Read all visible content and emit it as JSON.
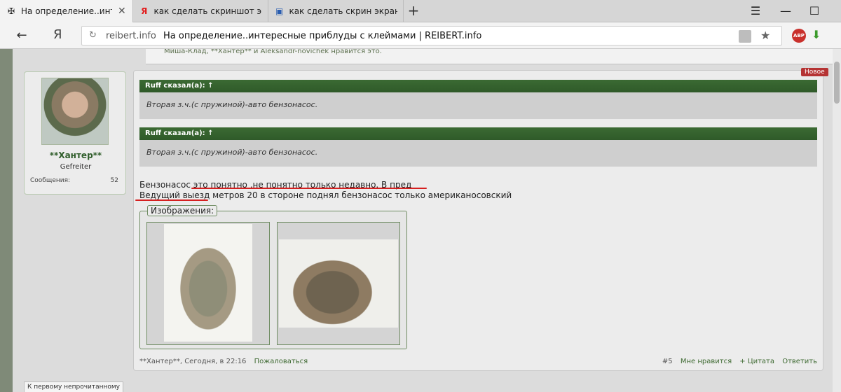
{
  "browser": {
    "tabs": [
      {
        "icon": "iron-cross-icon",
        "title": "На определение..интере",
        "active": true
      },
      {
        "icon": "yandex-icon",
        "title": "как сделать скриншот экра",
        "active": false
      },
      {
        "icon": "monitor-icon",
        "title": "как сделать скрин экрана н",
        "active": false
      }
    ],
    "new_tab": "+",
    "address": {
      "domain": "reibert.info",
      "title": "На определение..интересные приблуды с клеймами | REIBERT.info",
      "ya_label": "Я"
    },
    "abp_label": "ABP"
  },
  "prev_post": {
    "likes_text": "Миша-Клад, **Хантер** и Aleksandr-novichek нравится это."
  },
  "user": {
    "name": "**Хантер**",
    "rank": "Gefreiter",
    "messages_label": "Сообщения:",
    "messages_count": "52"
  },
  "post": {
    "badge": "Новое",
    "quotes": [
      {
        "header": "Ruff сказал(а): ↑",
        "body": "Вторая з.ч.(с пружиной)-авто бензонасос."
      },
      {
        "header": "Ruff сказал(а): ↑",
        "body": "Вторая з.ч.(с пружиной)-авто бензонасос."
      }
    ],
    "text_line1": "Бензонасос это понятно ,не понятно только недавно. В пред",
    "text_line2": "Ведущий выезд метров 20 в стороне поднял бензонасос только американосовский",
    "images_legend": "Изображения:",
    "footer": {
      "author": "**Хантер**, Сегодня, в 22:16",
      "report": "Пожаловаться",
      "post_number": "#5",
      "like": "Мне нравится",
      "quote": "+ Цитата",
      "reply": "Ответить"
    }
  },
  "jump_unread": "К первому непрочитанному"
}
